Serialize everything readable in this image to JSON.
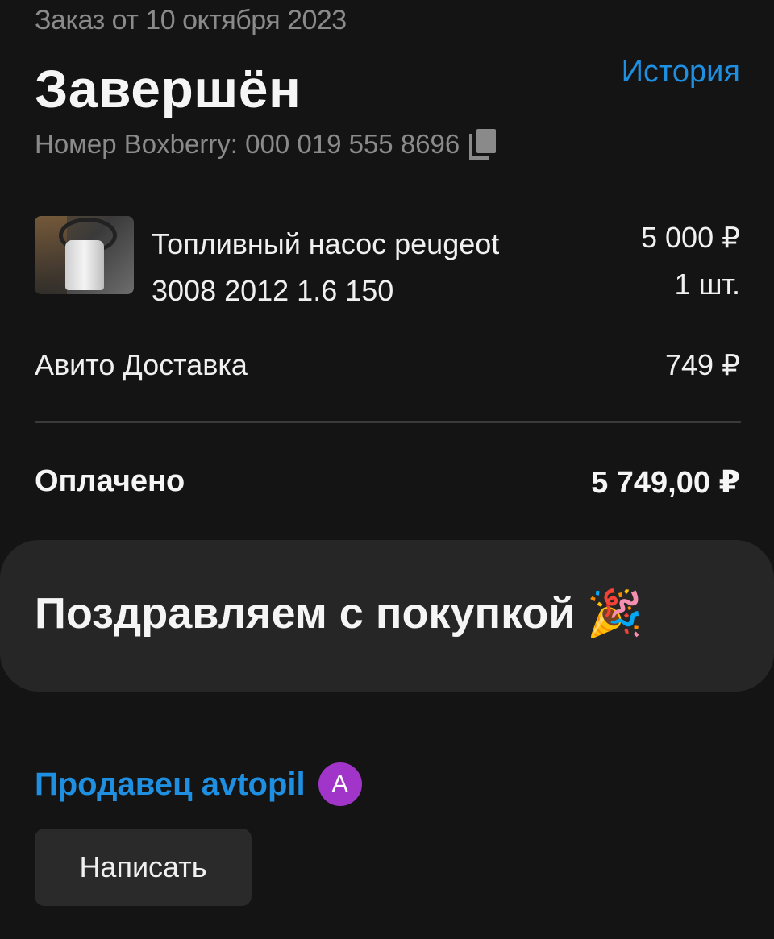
{
  "order": {
    "date_text": "Заказ от 10 октября 2023",
    "status": "Завершён",
    "history_link": "История",
    "tracking_text": "Номер Boxberry: 000 019 555 8696"
  },
  "product": {
    "name": "Топливный насос peugeot 3008 2012 1.6 150",
    "price": "5 000 ₽",
    "quantity": "1 шт."
  },
  "delivery": {
    "label": "Авито Доставка",
    "price": "749 ₽"
  },
  "payment": {
    "label": "Оплачено",
    "amount": "5 749,00 ₽"
  },
  "congrats": {
    "text": "Поздравляем с покупкой",
    "emoji": "🎉"
  },
  "seller": {
    "link_text": "Продавец avtopil",
    "avatar_letter": "A",
    "avatar_color": "#a135c9"
  },
  "actions": {
    "write_button": "Написать"
  },
  "colors": {
    "background": "#141414",
    "accent_link": "#1e8fe1",
    "secondary_text": "#8a8a8a",
    "card_background": "#262626"
  },
  "icons": {
    "copy": "copy-icon",
    "party": "party-popper-icon"
  }
}
